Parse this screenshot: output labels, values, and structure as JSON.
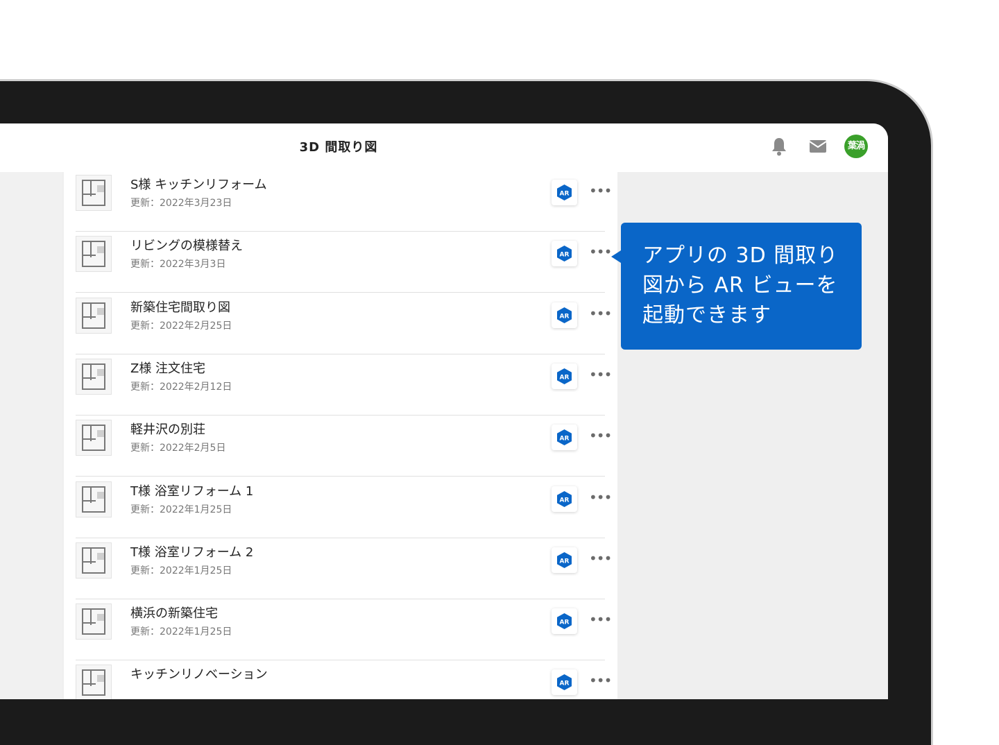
{
  "header": {
    "title": "3D 間取り図",
    "avatar_text": "葉渦"
  },
  "icons": {
    "bell": "bell-icon",
    "mail": "mail-icon",
    "ar": "ar-icon",
    "more": "more-icon"
  },
  "ar_label": "AR",
  "colors": {
    "accent": "#0a66c8",
    "avatar": "#3aa02a"
  },
  "items": [
    {
      "name": "S様 キッチンリフォーム",
      "date": "更新：2022年3月23日"
    },
    {
      "name": "リビングの模様替え",
      "date": "更新：2022年3月3日"
    },
    {
      "name": "新築住宅間取り図",
      "date": "更新：2022年2月25日"
    },
    {
      "name": "Z様 注文住宅",
      "date": "更新：2022年2月12日"
    },
    {
      "name": "軽井沢の別荘",
      "date": "更新：2022年2月5日"
    },
    {
      "name": "T様 浴室リフォーム 1",
      "date": "更新：2022年1月25日"
    },
    {
      "name": "T様 浴室リフォーム 2",
      "date": "更新：2022年1月25日"
    },
    {
      "name": "横浜の新築住宅",
      "date": "更新：2022年1月25日"
    },
    {
      "name": "キッチンリノベーション",
      "date": ""
    }
  ],
  "callout": {
    "line1": "アプリの 3D 間取り",
    "line2": "図から AR ビューを",
    "line3": "起動できます"
  }
}
